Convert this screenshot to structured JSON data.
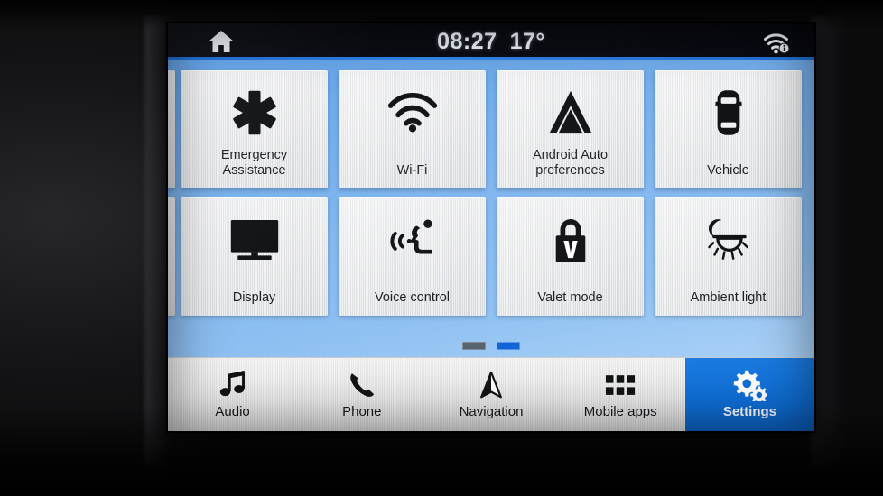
{
  "status_bar": {
    "home_icon": "home-icon",
    "clock": "08:27",
    "temperature": "17°",
    "wifi_icon": "wifi-info-icon"
  },
  "theme": {
    "page_background_blue": "#74aeec",
    "accent_blue": "#0f6ed6",
    "tile_gray": "#e6e8ea",
    "status_bar_black": "#05060c"
  },
  "settings_grid": {
    "tiles": [
      {
        "label": "Emergency\nAssistance",
        "icon": "star-of-life-icon"
      },
      {
        "label": "Wi-Fi",
        "icon": "wifi-icon"
      },
      {
        "label": "Android Auto\npreferences",
        "icon": "android-auto-icon"
      },
      {
        "label": "Vehicle",
        "icon": "car-top-view-icon"
      },
      {
        "label": "Display",
        "icon": "monitor-icon"
      },
      {
        "label": "Voice control",
        "icon": "voice-control-icon"
      },
      {
        "label": "Valet mode",
        "icon": "padlock-v-icon"
      },
      {
        "label": "Ambient light",
        "icon": "ambient-light-icon"
      }
    ]
  },
  "pagination": {
    "pages": 2,
    "current_page": 2,
    "dots": [
      {
        "state": "inactive"
      },
      {
        "state": "active"
      }
    ]
  },
  "bottom_nav": {
    "items": [
      {
        "label": "Audio",
        "icon": "music-note-icon",
        "active": false
      },
      {
        "label": "Phone",
        "icon": "phone-handset-icon",
        "active": false
      },
      {
        "label": "Navigation",
        "icon": "navigation-arrow-icon",
        "active": false
      },
      {
        "label": "Mobile apps",
        "icon": "app-grid-icon",
        "active": false
      },
      {
        "label": "Settings",
        "icon": "gears-icon",
        "active": true
      }
    ]
  }
}
